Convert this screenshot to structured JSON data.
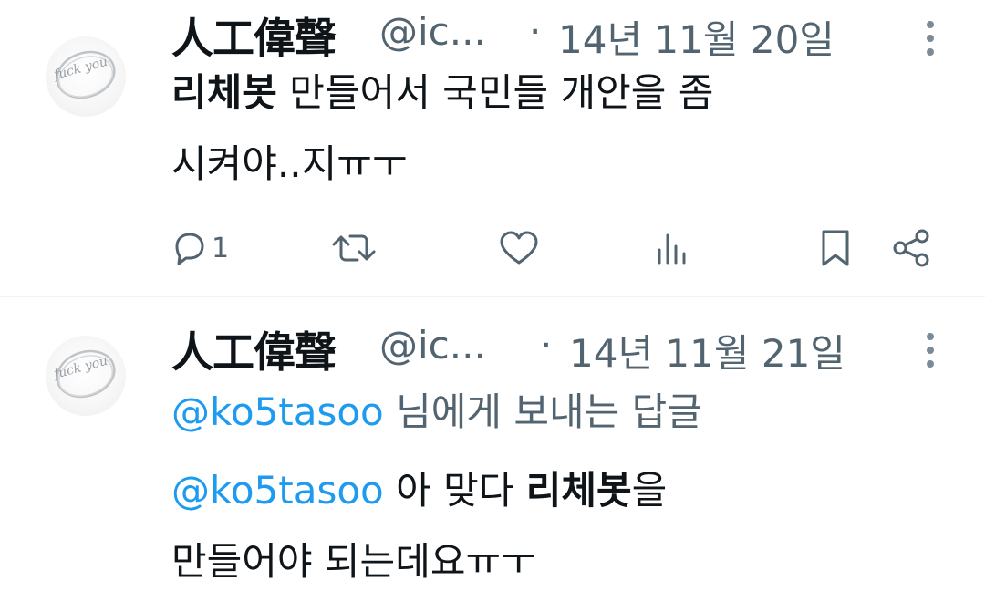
{
  "tweets": [
    {
      "display_name": "人工偉聲",
      "handle": "@ic...",
      "separator": "·",
      "date": "14년 11월 20일",
      "avatar_text": "fuck you",
      "lines": [
        {
          "bold": "리체봇",
          "rest": " 만들어서 국민들 개안을 좀"
        },
        {
          "text": "시켜야..지ㅠㅜ"
        }
      ],
      "actions": {
        "reply_count": "1",
        "retweet_count": "",
        "like_count": "",
        "views_count": ""
      }
    },
    {
      "display_name": "人工偉聲",
      "handle": "@ic...",
      "separator": "·",
      "date": "14년 11월 21일",
      "avatar_text": "fuck you",
      "reply_to": {
        "mention": "@ko5tasoo",
        "label": " 님에게 보내는 답글"
      },
      "lines": [
        {
          "mention": "@ko5tasoo",
          "text": " 아 맞다 ",
          "bold": "리체봇",
          "rest": "을"
        },
        {
          "text": "만들어야 되는데요ㅠㅜ"
        }
      ]
    }
  ],
  "colors": {
    "text": "#0f1419",
    "secondary": "#536471",
    "link": "#1d9bf0",
    "divider": "#eff3f4"
  },
  "icons": [
    "more-vertical-icon",
    "reply-icon",
    "retweet-icon",
    "like-icon",
    "views-icon",
    "bookmark-icon",
    "share-icon"
  ]
}
